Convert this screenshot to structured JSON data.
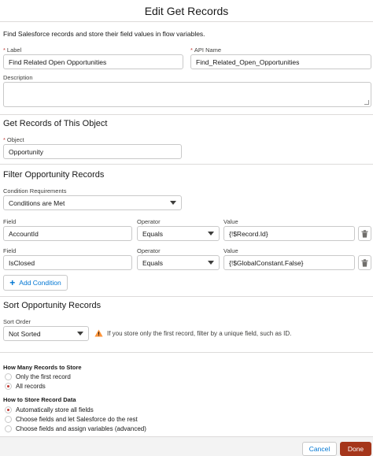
{
  "modal": {
    "title": "Edit Get Records"
  },
  "intro_text": "Find Salesforce records and store their field values in flow variables.",
  "label_field": {
    "label": "Label",
    "required_mark": "*",
    "value": "Find Related Open Opportunities"
  },
  "api_name_field": {
    "label": "API Name",
    "required_mark": "*",
    "value": "Find_Related_Open_Opportunities"
  },
  "description_field": {
    "label": "Description",
    "value": ""
  },
  "object_section": {
    "title": "Get Records of This Object",
    "object_label": "Object",
    "required_mark": "*",
    "object_value": "Opportunity"
  },
  "filter_section": {
    "title": "Filter Opportunity Records",
    "condition_requirements_label": "Condition Requirements",
    "condition_requirements_value": "Conditions are Met",
    "column_labels": {
      "field": "Field",
      "operator": "Operator",
      "value": "Value"
    },
    "conditions": [
      {
        "field": "AccountId",
        "operator": "Equals",
        "value": "{!$Record.Id}"
      },
      {
        "field": "IsClosed",
        "operator": "Equals",
        "value": "{!$GlobalConstant.False}"
      }
    ],
    "add_condition_label": "Add Condition"
  },
  "sort_section": {
    "title": "Sort Opportunity Records",
    "sort_order_label": "Sort Order",
    "sort_order_value": "Not Sorted",
    "warning_text": "If you store only the first record, filter by a unique field, such as ID."
  },
  "how_many": {
    "heading": "How Many Records to Store",
    "options": [
      {
        "label": "Only the first record",
        "selected": false
      },
      {
        "label": "All records",
        "selected": true
      }
    ]
  },
  "how_to_store": {
    "heading": "How to Store Record Data",
    "options": [
      {
        "label": "Automatically store all fields",
        "selected": true
      },
      {
        "label": "Choose fields and let Salesforce do the rest",
        "selected": false
      },
      {
        "label": "Choose fields and assign variables (advanced)",
        "selected": false
      }
    ]
  },
  "footer": {
    "cancel_label": "Cancel",
    "done_label": "Done"
  },
  "colors": {
    "brand_blue": "#0176d3",
    "required_red": "#c23934",
    "done_button": "#a5361b",
    "warning_yellow": "#fe9339"
  }
}
